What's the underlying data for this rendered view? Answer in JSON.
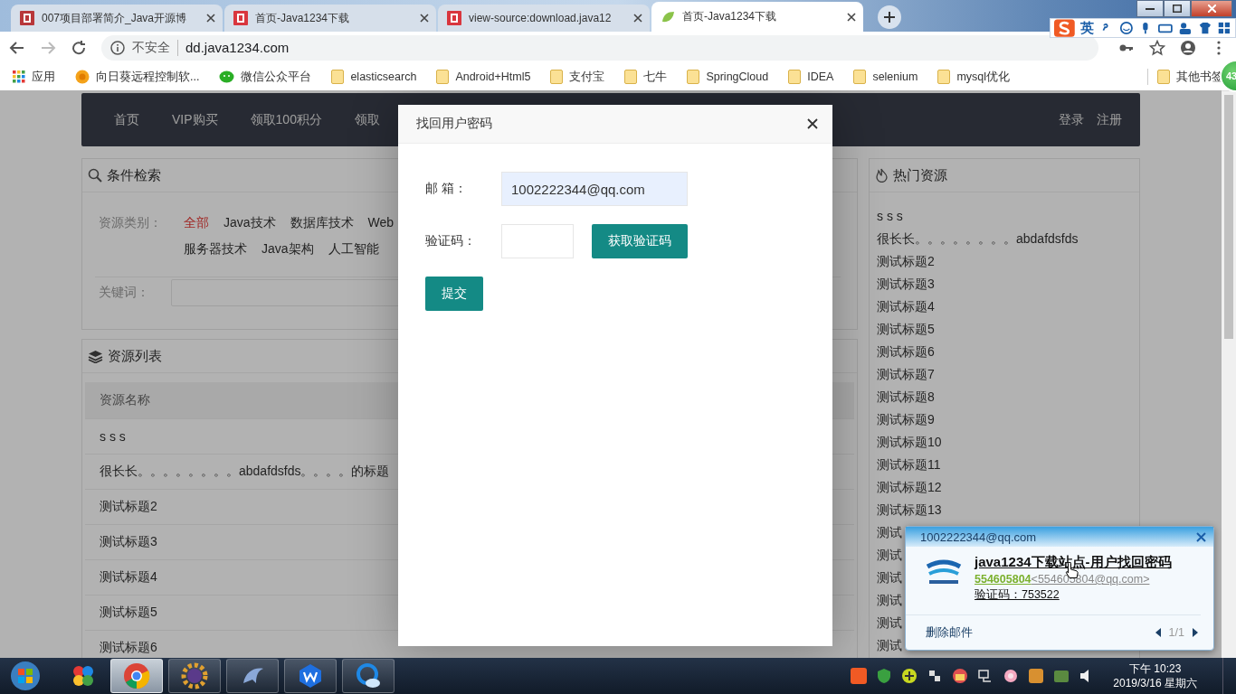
{
  "browser": {
    "tabs": [
      {
        "title": "007项目部署简介_Java开源博",
        "kind": "b",
        "selected": false
      },
      {
        "title": "首页-Java1234下载",
        "kind": "d",
        "selected": false
      },
      {
        "title": "view-source:download.java12",
        "kind": "d",
        "selected": false
      },
      {
        "title": "首页-Java1234下载",
        "kind": "leaf",
        "selected": true
      }
    ],
    "address": {
      "security": "不安全",
      "url": "dd.java1234.com"
    },
    "bookmarks": [
      {
        "label": "应用",
        "kind": "apps"
      },
      {
        "label": "向日葵远程控制软...",
        "kind": "sunflower"
      },
      {
        "label": "微信公众平台",
        "kind": "wechat"
      },
      {
        "label": "elasticsearch",
        "kind": "folder"
      },
      {
        "label": "Android+Html5",
        "kind": "folder"
      },
      {
        "label": "支付宝",
        "kind": "folder"
      },
      {
        "label": "七牛",
        "kind": "folder"
      },
      {
        "label": "SpringCloud",
        "kind": "folder"
      },
      {
        "label": "IDEA",
        "kind": "folder"
      },
      {
        "label": "selenium",
        "kind": "folder"
      },
      {
        "label": "mysql优化",
        "kind": "folder"
      }
    ],
    "other_bookmarks": "其他书签"
  },
  "ime": {
    "mode": "英"
  },
  "badge": "43",
  "site": {
    "nav": [
      "首页",
      "VIP购买",
      "领取100积分",
      "领取"
    ],
    "account": [
      "登录",
      "注册"
    ],
    "filter": {
      "title": "条件检索",
      "category_label": "资源类别：",
      "categories": [
        [
          {
            "label": "全部",
            "selected": true
          },
          {
            "label": "Java技术",
            "selected": false
          },
          {
            "label": "数据库技术",
            "selected": false
          },
          {
            "label": "Web",
            "selected": false
          }
        ],
        [
          {
            "label": "服务器技术",
            "selected": false
          },
          {
            "label": "Java架构",
            "selected": false
          },
          {
            "label": "人工智能",
            "selected": false
          }
        ]
      ],
      "keyword_label": "关键词："
    },
    "list": {
      "title": "资源列表",
      "column": "资源名称",
      "rows": [
        "s s s",
        "很长长。。。。。。。。abdafdsfds。。。。的标题",
        "测试标题2",
        "测试标题3",
        "测试标题4",
        "测试标题5",
        "测试标题6"
      ]
    },
    "hot": {
      "title": "热门资源",
      "items": [
        "s s s",
        "很长长。。。。。。。。abdafdsfds",
        "测试标题2",
        "测试标题3",
        "测试标题4",
        "测试标题5",
        "测试标题6",
        "测试标题7",
        "测试标题8",
        "测试标题9",
        "测试标题10",
        "测试标题11",
        "测试标题12",
        "测试标题13",
        "测试",
        "测试",
        "测试",
        "测试",
        "测试",
        "测试"
      ]
    }
  },
  "modal": {
    "title": "找回用户密码",
    "email_label": "邮 箱：",
    "email_value": "1002222344@qq.com",
    "code_label": "验证码：",
    "get_code": "获取验证码",
    "submit": "提交"
  },
  "mail_popup": {
    "account": "1002222344@qq.com",
    "subject": "java1234下载站点-用户找回密码",
    "sender_name": "554605804",
    "sender_address": "<554605804@qq.com>",
    "body": "验证码：753522",
    "delete": "删除邮件",
    "pager": "1/1"
  },
  "taskbar": {
    "apps": [
      {
        "kind": "pinwheel",
        "selected": false
      },
      {
        "kind": "chrome",
        "selected": true
      },
      {
        "kind": "ide",
        "selected": false
      },
      {
        "kind": "dolphin",
        "selected": false
      },
      {
        "kind": "wps",
        "selected": false
      },
      {
        "kind": "cloud",
        "selected": false
      }
    ],
    "clock": {
      "time": "下午 10:23",
      "date": "2019/3/16 星期六"
    }
  }
}
